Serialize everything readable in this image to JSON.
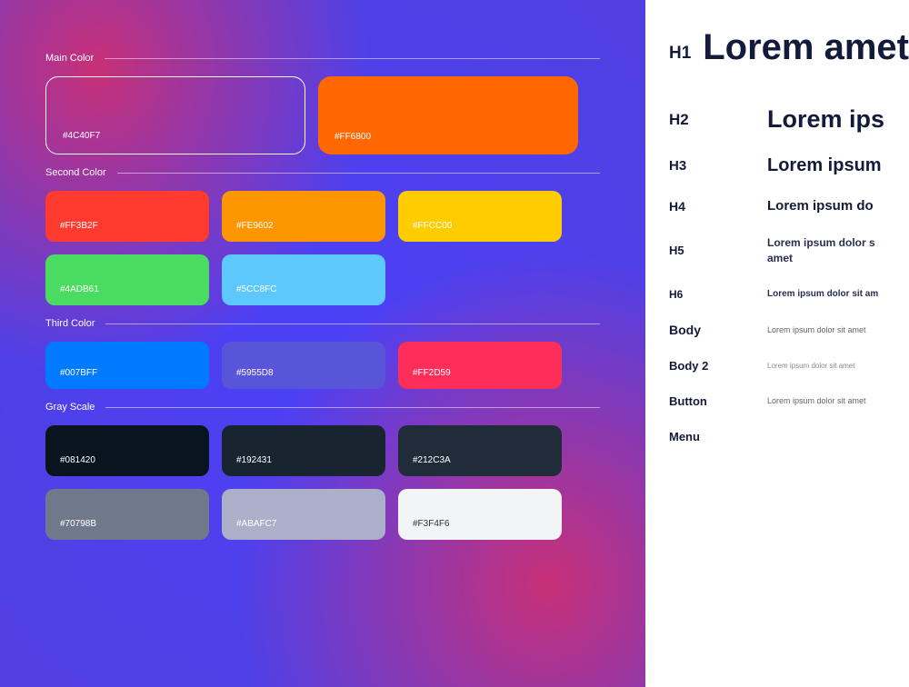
{
  "sections": {
    "main": {
      "title": "Main Color",
      "swatches": [
        {
          "hex": "#4C40F7",
          "bg": "transparent",
          "outlined": true
        },
        {
          "hex": "#FF6800",
          "bg": "#FF6800"
        }
      ]
    },
    "second": {
      "title": "Second Color",
      "row1": [
        {
          "hex": "#FF3B2F",
          "bg": "#FF3B2F"
        },
        {
          "hex": "#FE9602",
          "bg": "#FE9602"
        },
        {
          "hex": "#FFCC00",
          "bg": "#FFCC00"
        }
      ],
      "row2": [
        {
          "hex": "#4ADB61",
          "bg": "#4ADB61"
        },
        {
          "hex": "#5CC8FC",
          "bg": "#5CC8FC"
        }
      ]
    },
    "third": {
      "title": "Third Color",
      "swatches": [
        {
          "hex": "#007BFF",
          "bg": "#007BFF"
        },
        {
          "hex": "#5955D8",
          "bg": "#5955D8"
        },
        {
          "hex": "#FF2D59",
          "bg": "#FF2D59"
        }
      ]
    },
    "gray": {
      "title": "Gray Scale",
      "row1": [
        {
          "hex": "#081420",
          "bg": "#081420"
        },
        {
          "hex": "#192431",
          "bg": "#192431"
        },
        {
          "hex": "#212C3A",
          "bg": "#212C3A"
        }
      ],
      "row2": [
        {
          "hex": "#70798B",
          "bg": "#70798B"
        },
        {
          "hex": "#ABAFC7",
          "bg": "#ABAFC7"
        },
        {
          "hex": "#F3F4F6",
          "bg": "#F3F4F6",
          "text": "#333"
        }
      ]
    }
  },
  "typography": {
    "h1": {
      "label": "H1",
      "sample": "Lorem amet"
    },
    "h2": {
      "label": "H2",
      "sample": "Lorem ips"
    },
    "h3": {
      "label": "H3",
      "sample": "Lorem ipsum"
    },
    "h4": {
      "label": "H4",
      "sample": "Lorem ipsum do"
    },
    "h5": {
      "label": "H5",
      "sample": "Lorem ipsum dolor s amet"
    },
    "h6": {
      "label": "H6",
      "sample": "Lorem ipsum dolor sit am"
    },
    "body": {
      "label": "Body",
      "sample": "Lorem ipsum dolor sit amet"
    },
    "body2": {
      "label": "Body 2",
      "sample": "Lorem ipsum dolor sit amet"
    },
    "button": {
      "label": "Button",
      "sample": "Lorem ipsum dolor sit amet"
    },
    "menu": {
      "label": "Menu",
      "sample": ""
    }
  }
}
